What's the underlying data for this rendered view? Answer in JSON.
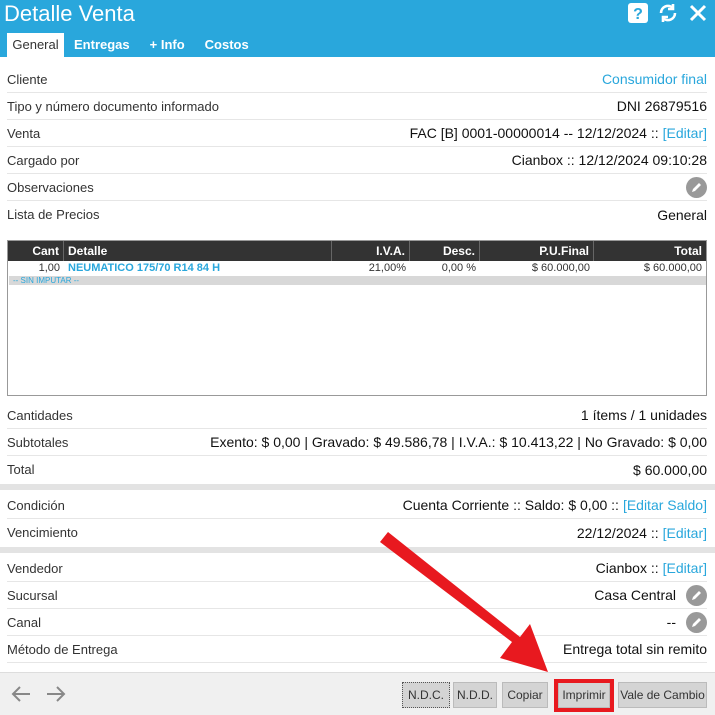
{
  "window": {
    "title": "Detalle Venta",
    "icons": [
      "help-icon",
      "refresh-icon",
      "close-icon"
    ]
  },
  "tabs": [
    "General",
    "Entregas",
    "+ Info",
    "Costos"
  ],
  "fields": {
    "cliente": {
      "label": "Cliente",
      "value": "Consumidor final"
    },
    "documento": {
      "label": "Tipo y número documento informado",
      "value": "DNI 26879516"
    },
    "venta": {
      "label": "Venta",
      "value": "FAC [B] 0001-00000014 -- 12/12/2024 ::",
      "link": "[Editar]"
    },
    "cargado": {
      "label": "Cargado por",
      "value": "Cianbox :: 12/12/2024 09:10:28"
    },
    "observaciones": {
      "label": "Observaciones"
    },
    "lista": {
      "label": "Lista de Precios",
      "value": "General"
    }
  },
  "table": {
    "headers": [
      "Cant",
      "Detalle",
      "I.V.A.",
      "Desc.",
      "P.U.Final",
      "Total"
    ],
    "rows": [
      [
        "1,00",
        "NEUMATICO 175/70 R14 84 H",
        "21,00%",
        "0,00 %",
        "$ 60.000,00",
        "$ 60.000,00"
      ]
    ],
    "unassigned": "-- SIN IMPUTAR --"
  },
  "totals": {
    "cantidades": {
      "label": "Cantidades",
      "value": "1 ítems / 1 unidades"
    },
    "subtotales": {
      "label": "Subtotales",
      "value": "Exento: $ 0,00 | Gravado: $ 49.586,78 | I.V.A.: $ 10.413,22 | No Gravado: $ 0,00"
    },
    "total": {
      "label": "Total",
      "value": "$ 60.000,00"
    }
  },
  "payment": {
    "condicion": {
      "label": "Condición",
      "value": "Cuenta Corriente :: Saldo: $ 0,00 ::",
      "link": "[Editar Saldo]"
    },
    "vencimiento": {
      "label": "Vencimiento",
      "value": "22/12/2024 ::",
      "link": "[Editar]"
    }
  },
  "extra": {
    "vendedor": {
      "label": "Vendedor",
      "value": "Cianbox ::",
      "link": "[Editar]"
    },
    "sucursal": {
      "label": "Sucursal",
      "value": "Casa Central"
    },
    "canal": {
      "label": "Canal",
      "value": "--"
    },
    "metodo": {
      "label": "Método de Entrega",
      "value": "Entrega total sin remito"
    }
  },
  "buttons": {
    "ndc": "N.D.C.",
    "ndd": "N.D.D.",
    "copiar": "Copiar",
    "imprimir": "Imprimir",
    "vale": "Vale de Cambio"
  },
  "colors": {
    "accent": "#29a7dc",
    "highlight": "#e8191f"
  }
}
